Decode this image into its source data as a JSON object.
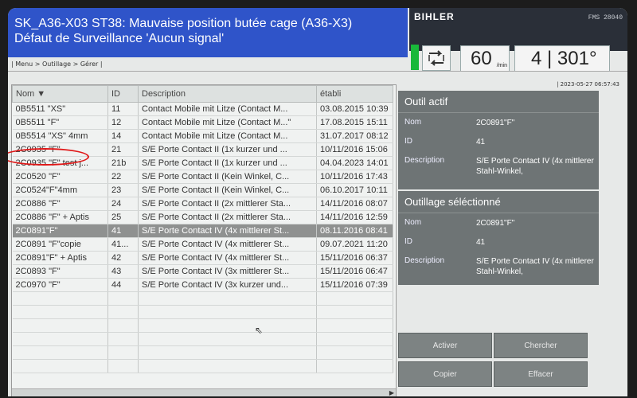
{
  "header": {
    "alarm_line1": "SK_A36-X03 ST38: Mauvaise position butée cage (A36-X3)",
    "alarm_line2": "Défaut de Surveillance 'Aucun signal'",
    "brand": "BIHLER",
    "brand_sub": "FMS 28040",
    "speed_value": "60",
    "speed_unit": "/min",
    "counter": "4 | 301°"
  },
  "breadcrumb": "| Menu > Outillage > Gérer |",
  "datetime": "| 2023-05-27 06:57:43",
  "table": {
    "headers": [
      "Nom ▼",
      "ID",
      "Description",
      "établi"
    ],
    "rows": [
      [
        "0B5511 \"XS\"",
        "11",
        "Contact Mobile mit Litze (Contact M...",
        "03.08.2015 10:39"
      ],
      [
        "0B5511 \"F\"",
        "12",
        "Contact Mobile mit Litze (Contact M...\"",
        "17.08.2015 15:11"
      ],
      [
        "0B5514 \"XS\" 4mm",
        "14",
        "Contact Mobile mit Litze (Contact M...",
        "31.07.2017 08:12"
      ],
      [
        "2C0935 \"F\"",
        "21",
        "S/E Porte Contact II (1x kurzer und ...",
        "10/11/2016 15:06"
      ],
      [
        "2C0935 \"F\" test j...",
        "21b",
        "S/E Porte Contact II (1x kurzer und ...",
        "04.04.2023 14:01"
      ],
      [
        "2C0520 \"F\"",
        "22",
        "S/E Porte Contact II (Kein Winkel, C...",
        "10/11/2016 17:43"
      ],
      [
        "2C0524\"F\"4mm",
        "23",
        "S/E Porte Contact II (Kein Winkel, C...",
        "06.10.2017 10:11"
      ],
      [
        "2C0886 \"F\"",
        "24",
        "S/E Porte Contact II (2x mittlerer Sta...",
        "14/11/2016 08:07"
      ],
      [
        "2C0886 \"F\" + Aptis",
        "25",
        "S/E Porte Contact II (2x mittlerer Sta...",
        "14/11/2016 12:59"
      ],
      [
        "2C0891\"F\"",
        "41",
        "S/E Porte Contact IV (4x mittlerer St...",
        "08.11.2016 08:41"
      ],
      [
        "2C0891 \"F\"copie",
        "41...",
        "S/E Porte Contact IV (4x mittlerer St...",
        "09.07.2021 11:20"
      ],
      [
        "2C0891\"F\" + Aptis",
        "42",
        "S/E Porte Contact IV (4x mittlerer St...",
        "15/11/2016 06:37"
      ],
      [
        "2C0893 \"F\"",
        "43",
        "S/E Porte Contact IV (3x mittlerer St...",
        "15/11/2016 06:47"
      ],
      [
        "2C0970 \"F\"",
        "44",
        "S/E Porte Contact IV (3x kurzer und...",
        "15/11/2016 07:39"
      ]
    ],
    "selected_index": 9
  },
  "outil_actif": {
    "title": "Outil actif",
    "nom_label": "Nom",
    "nom_value": "2C0891\"F\"",
    "id_label": "ID",
    "id_value": "41",
    "desc_label": "Description",
    "desc_value": "S/E Porte Contact IV (4x mittlerer Stahl-Winkel,"
  },
  "outillage_sel": {
    "title": "Outillage séléctionné",
    "nom_label": "Nom",
    "nom_value": "2C0891\"F\"",
    "id_label": "ID",
    "id_value": "41",
    "desc_label": "Description",
    "desc_value": "S/E Porte Contact IV (4x mittlerer Stahl-Winkel,"
  },
  "buttons": {
    "activer": "Activer",
    "chercher": "Chercher",
    "copier": "Copier",
    "effacer": "Effacer"
  }
}
